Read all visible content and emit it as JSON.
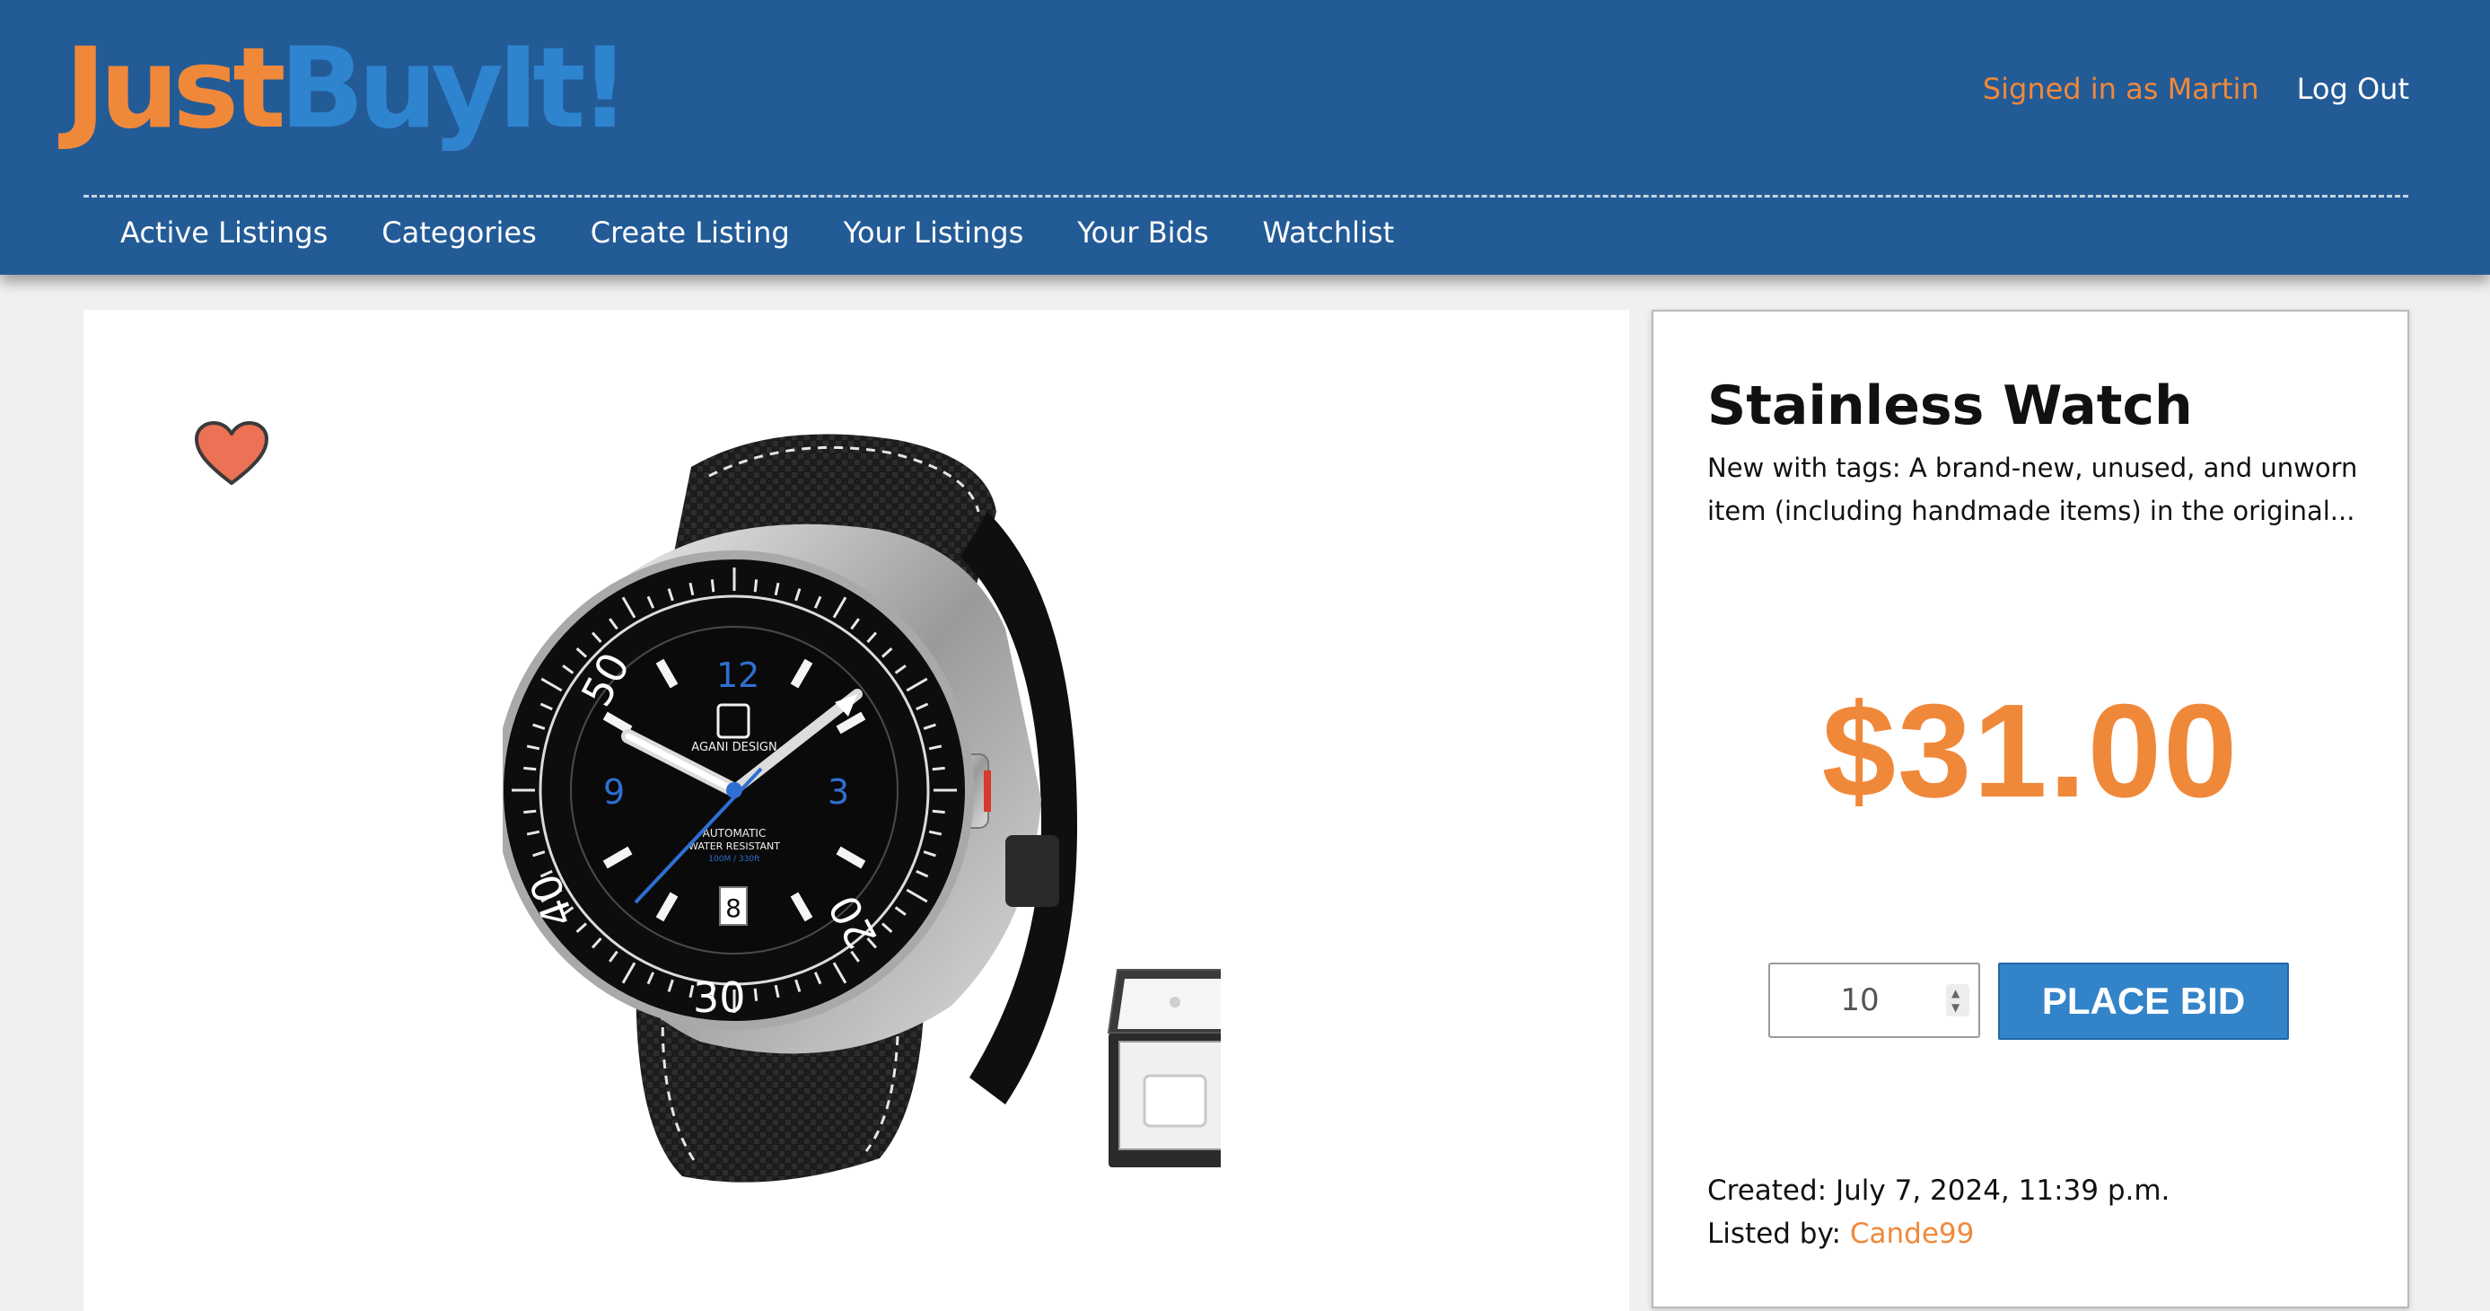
{
  "header": {
    "logo_part1": "Just",
    "logo_part2": "BuyIt!",
    "signed_in_text": "Signed in as Martin",
    "logout_label": "Log Out",
    "brand_orange": "#f0883a",
    "brand_blue": "#2f84cf",
    "header_bg": "#235b97"
  },
  "nav": {
    "items": [
      {
        "label": "Active Listings"
      },
      {
        "label": "Categories"
      },
      {
        "label": "Create Listing"
      },
      {
        "label": "Your Listings"
      },
      {
        "label": "Your Bids"
      },
      {
        "label": "Watchlist"
      }
    ]
  },
  "listing": {
    "title": "Stainless Watch",
    "description": "New with tags: A brand-new, unused, and unworn item (including handmade items) in the original...",
    "price": "$31.00",
    "bid_value": "10",
    "place_bid_label": "PLACE BID",
    "created_label": "Created:",
    "created_value": "July 7, 2024, 11:39 p.m.",
    "listed_by_label": "Listed by:",
    "seller": "Cande99",
    "watchlist_icon": "heart-icon",
    "watch_dial": {
      "brand": "AGANI DESIGN",
      "line1": "AUTOMATIC",
      "line2": "WATER RESISTANT",
      "line3": "100M / 330ft",
      "date": "8",
      "n12": "12",
      "n3": "3",
      "n9": "9",
      "bezel_50": "50",
      "bezel_40": "40",
      "bezel_30": "30",
      "bezel_20": "20"
    }
  }
}
